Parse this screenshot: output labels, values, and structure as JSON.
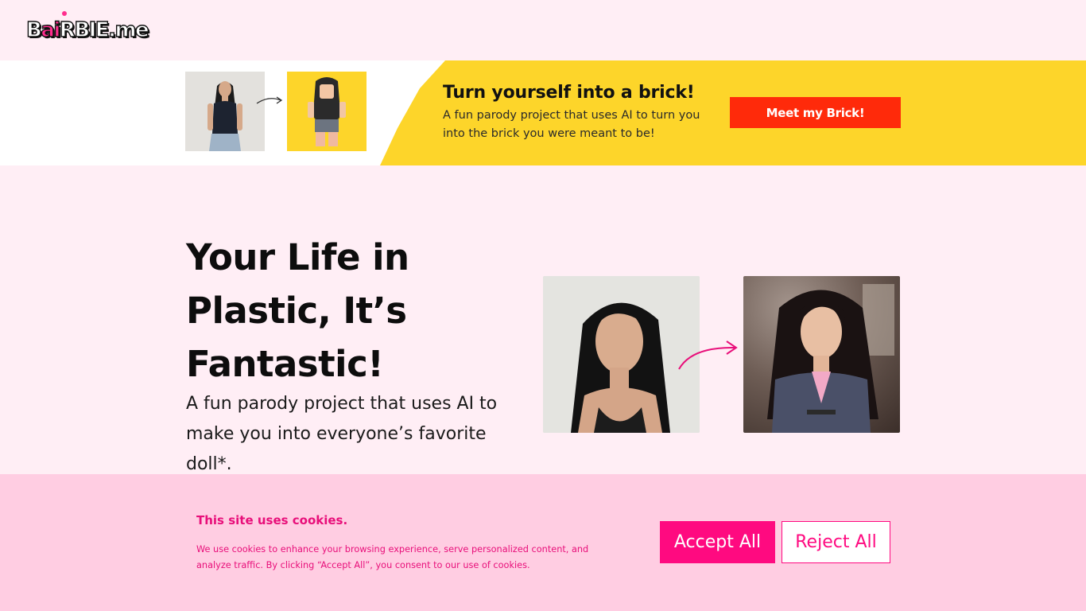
{
  "header": {
    "logo_prefix": "B",
    "logo_ai": "ai",
    "logo_suffix": "RBIE.me"
  },
  "banner": {
    "title": "Turn yourself into a brick!",
    "description": "A fun parody project that uses AI to turn you into the brick you were meant to be!",
    "button_label": "Meet my Brick!"
  },
  "hero": {
    "title": "Your Life in Plastic, It’s Fantastic!",
    "description": "A fun parody project that uses AI to make you into everyone’s favorite doll*."
  },
  "cookie": {
    "title": "This site uses cookies.",
    "text": "We use cookies to enhance your browsing experience, serve personalized content, and analyze traffic. By clicking “Accept All”, you consent to our use of cookies.",
    "accept_label": "Accept All",
    "reject_label": "Reject All"
  },
  "colors": {
    "page_background": "#ffeef5",
    "brand_pink": "#ff0a80",
    "banner_yellow": "#fdd52a",
    "brick_button": "#ff2a0a",
    "cookie_background": "#ffcde2"
  },
  "icons": [
    "arrow-right-icon",
    "curved-arrow-icon"
  ]
}
